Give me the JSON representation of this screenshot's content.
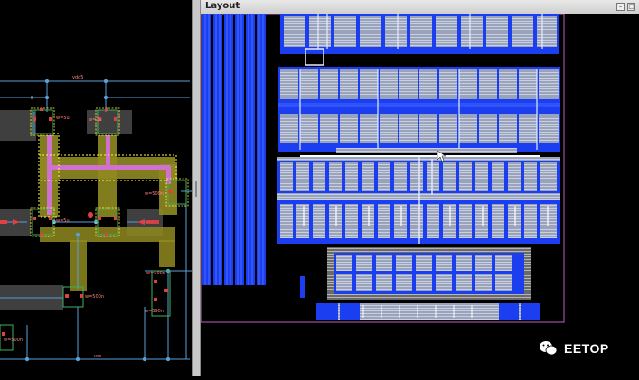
{
  "layout_window": {
    "title": "Layout"
  },
  "schematic": {
    "net_labels": {
      "vdd": "vdd5",
      "vss": "vss"
    },
    "device_labels": [
      "w=5u",
      "w=1u",
      "w=5u",
      "w=500n",
      "w=500n",
      "w=500n",
      "w=590n",
      "w=500n"
    ]
  },
  "watermark": {
    "text": "EETOP"
  },
  "colors": {
    "schematic_wire": "#5aa0d8",
    "highlight_yellow": "#e6e04a",
    "highlight_magenta": "#d070d0",
    "layout_blue": "#1a3ef0",
    "layout_grey": "#aeb6c8"
  }
}
